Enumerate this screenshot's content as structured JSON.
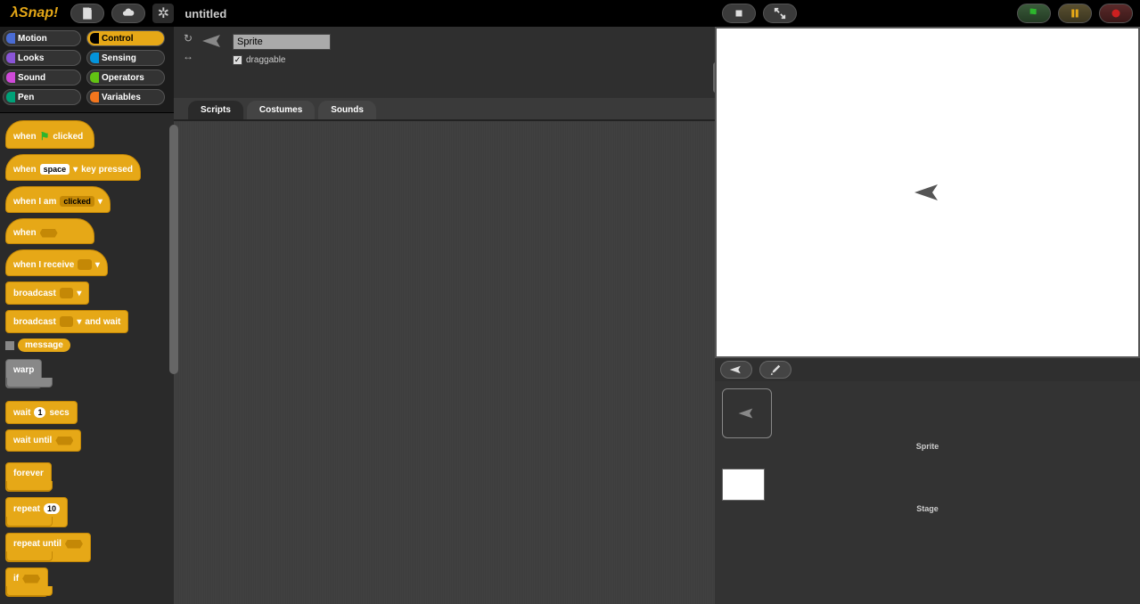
{
  "app": {
    "logo": "λSnap!",
    "title": "untitled"
  },
  "categories": [
    {
      "id": "motion",
      "label": "Motion",
      "color": "#4a6cd4"
    },
    {
      "id": "control",
      "label": "Control",
      "color": "#e6a817",
      "active": true
    },
    {
      "id": "looks",
      "label": "Looks",
      "color": "#8a55d7"
    },
    {
      "id": "sensing",
      "label": "Sensing",
      "color": "#0494dc"
    },
    {
      "id": "sound",
      "label": "Sound",
      "color": "#cf4ad9"
    },
    {
      "id": "operators",
      "label": "Operators",
      "color": "#62c213"
    },
    {
      "id": "pen",
      "label": "Pen",
      "color": "#00a178"
    },
    {
      "id": "variables",
      "label": "Variables",
      "color": "#f3761d"
    }
  ],
  "blocks": {
    "when_flag_clicked_pre": "when",
    "when_flag_clicked_post": "clicked",
    "when_key_pre": "when",
    "when_key_slot": "space",
    "when_key_post": "key pressed",
    "when_iam_pre": "when I am",
    "when_iam_slot": "clicked",
    "when_cond": "when",
    "when_receive": "when I receive",
    "broadcast": "broadcast",
    "broadcast_wait_pre": "broadcast",
    "broadcast_wait_post": "and wait",
    "message": "message",
    "warp": "warp",
    "wait_pre": "wait",
    "wait_val": "1",
    "wait_post": "secs",
    "wait_until": "wait until",
    "forever": "forever",
    "repeat": "repeat",
    "repeat_val": "10",
    "repeat_until": "repeat until",
    "if": "if"
  },
  "sprite": {
    "name": "Sprite",
    "draggable_label": "draggable",
    "draggable": true
  },
  "tabs": {
    "scripts": "Scripts",
    "costumes": "Costumes",
    "sounds": "Sounds"
  },
  "corral": {
    "sprite_label": "Sprite",
    "stage_label": "Stage"
  },
  "icons": {
    "file": "file-icon",
    "cloud": "cloud-icon",
    "settings": "gear-icon",
    "small_stage": "shrink-icon",
    "fullscreen": "expand-icon",
    "flag": "flag-icon",
    "pause": "pause-icon",
    "stop": "stop-icon",
    "rotate": "rotate-icon",
    "flip": "flip-icon",
    "turtle": "arrow-sprite-icon",
    "paint": "paintbrush-icon"
  }
}
